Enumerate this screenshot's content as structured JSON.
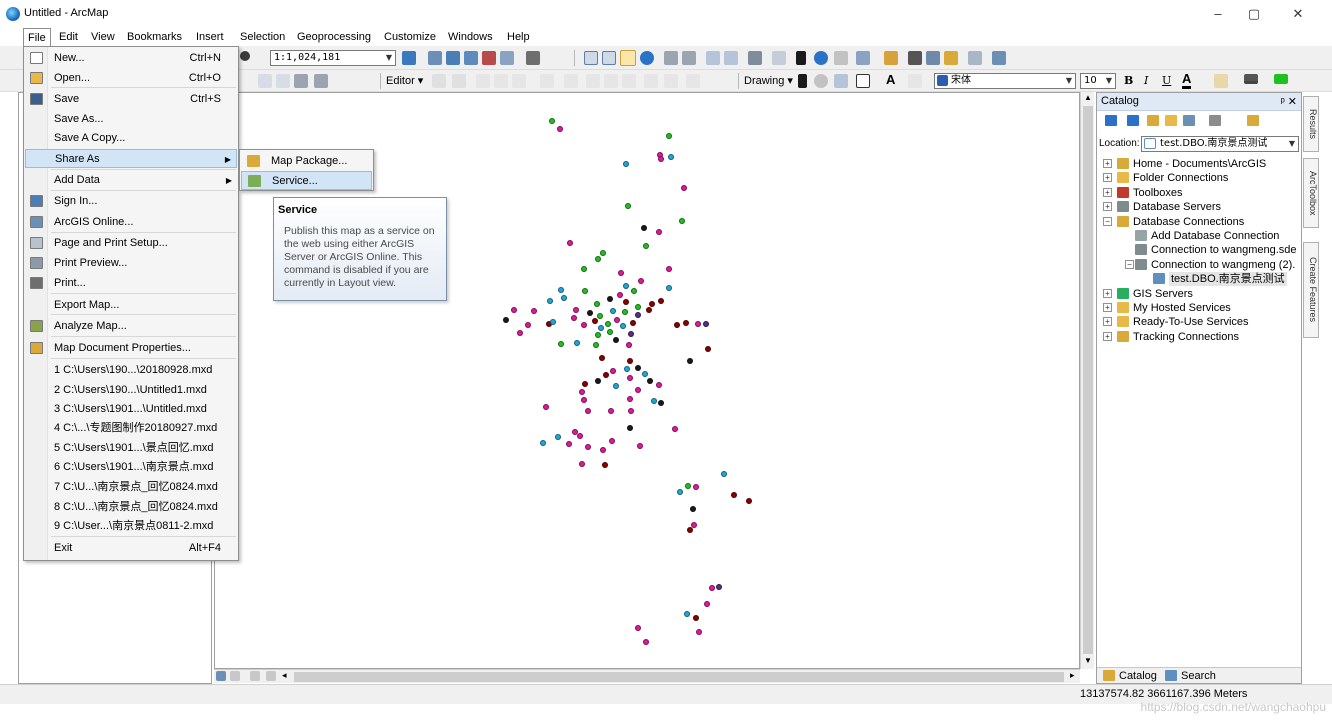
{
  "window": {
    "title": "Untitled - ArcMap",
    "controls": {
      "minimize": "–",
      "maximize": "▢",
      "close": "✕"
    }
  },
  "menubar": {
    "items": [
      "File",
      "Edit",
      "View",
      "Bookmarks",
      "Insert",
      "Selection",
      "Geoprocessing",
      "Customize",
      "Windows",
      "Help"
    ]
  },
  "toolbars": {
    "scale_value": "1:1,024,181",
    "editor_label": "Editor ▾",
    "drawing_label": "Drawing ▾",
    "font_name": "宋体",
    "font_size": "10",
    "bold": "B",
    "italic": "I",
    "underline": "U",
    "font_color_glyph": "A"
  },
  "file_menu": {
    "items": [
      {
        "label": "New...",
        "shortcut": "Ctrl+N",
        "icon": "new-document-icon"
      },
      {
        "label": "Open...",
        "shortcut": "Ctrl+O",
        "icon": "open-folder-icon"
      },
      {
        "label": "Save",
        "shortcut": "Ctrl+S",
        "icon": "save-disk-icon"
      },
      {
        "label": "Save As...",
        "shortcut": ""
      },
      {
        "label": "Save A Copy...",
        "shortcut": ""
      },
      {
        "label": "Share As",
        "shortcut": "",
        "submenu": true,
        "highlighted": true
      },
      {
        "label": "Add Data",
        "shortcut": "",
        "submenu": true
      },
      {
        "label": "Sign In...",
        "shortcut": "",
        "icon": "sign-in-icon"
      },
      {
        "label": "ArcGIS Online...",
        "shortcut": "",
        "icon": "arcgis-online-icon"
      },
      {
        "label": "Page and Print Setup...",
        "shortcut": "",
        "icon": "page-setup-icon"
      },
      {
        "label": "Print Preview...",
        "shortcut": "",
        "icon": "print-preview-icon"
      },
      {
        "label": "Print...",
        "shortcut": "",
        "icon": "printer-icon"
      },
      {
        "label": "Export Map...",
        "shortcut": ""
      },
      {
        "label": "Analyze Map...",
        "shortcut": "",
        "icon": "analyze-map-icon"
      },
      {
        "label": "Map Document Properties...",
        "shortcut": "",
        "icon": "document-properties-icon"
      },
      {
        "label": "1 C:\\Users\\190...\\20180928.mxd",
        "shortcut": ""
      },
      {
        "label": "2 C:\\Users\\190...\\Untitled1.mxd",
        "shortcut": ""
      },
      {
        "label": "3 C:\\Users\\1901...\\Untitled.mxd",
        "shortcut": ""
      },
      {
        "label": "4 C:\\...\\专题图制作20180927.mxd",
        "shortcut": ""
      },
      {
        "label": "5 C:\\Users\\1901...\\景点回忆.mxd",
        "shortcut": ""
      },
      {
        "label": "6 C:\\Users\\1901...\\南京景点.mxd",
        "shortcut": ""
      },
      {
        "label": "7 C:\\U...\\南京景点_回忆0824.mxd",
        "shortcut": ""
      },
      {
        "label": "8 C:\\U...\\南京景点_回忆0824.mxd",
        "shortcut": ""
      },
      {
        "label": "9 C:\\User...\\南京景点0811-2.mxd",
        "shortcut": ""
      },
      {
        "label": "Exit",
        "shortcut": "Alt+F4"
      }
    ]
  },
  "share_as_submenu": {
    "items": [
      {
        "label": "Map Package...",
        "icon": "map-package-icon"
      },
      {
        "label": "Service...",
        "icon": "service-icon",
        "highlighted": true
      }
    ]
  },
  "tooltip": {
    "title": "Service",
    "body": "Publish this map as a service on the web using either ArcGIS Server or ArcGIS Online. This command is disabled if you are currently in Layout view."
  },
  "catalog": {
    "title": "Catalog",
    "pin_close": "ᵖ ✕",
    "location_label": "Location:",
    "location_value": "test.DBO.南京景点测试",
    "tree": [
      {
        "label": "Home - Documents\\ArcGIS",
        "depth": 0,
        "expander": "+",
        "color": "#d9a93a"
      },
      {
        "label": "Folder Connections",
        "depth": 0,
        "expander": "+",
        "color": "#e8b848"
      },
      {
        "label": "Toolboxes",
        "depth": 0,
        "expander": "+",
        "color": "#c0392b"
      },
      {
        "label": "Database Servers",
        "depth": 0,
        "expander": "+",
        "color": "#7f8c8d"
      },
      {
        "label": "Database Connections",
        "depth": 0,
        "expander": "−",
        "color": "#d9a93a"
      },
      {
        "label": "Add Database Connection",
        "depth": 1,
        "expander": "",
        "color": "#95a5a6"
      },
      {
        "label": "Connection to wangmeng.sde",
        "depth": 1,
        "expander": "",
        "color": "#7f8c8d"
      },
      {
        "label": "Connection to wangmeng (2).",
        "depth": 1,
        "expander": "−",
        "color": "#7f8c8d"
      },
      {
        "label": "test.DBO.南京景点测试",
        "depth": 2,
        "expander": "",
        "color": "#5d8fbf",
        "selected": true
      },
      {
        "label": "GIS Servers",
        "depth": 0,
        "expander": "+",
        "color": "#27ae60"
      },
      {
        "label": "My Hosted Services",
        "depth": 0,
        "expander": "+",
        "color": "#e8b848"
      },
      {
        "label": "Ready-To-Use Services",
        "depth": 0,
        "expander": "+",
        "color": "#e8b848"
      },
      {
        "label": "Tracking Connections",
        "depth": 0,
        "expander": "+",
        "color": "#d9a93a"
      }
    ],
    "tabs": [
      "Catalog",
      "Search"
    ]
  },
  "side_tabs": [
    "Results",
    "ArcToolbox",
    "Create Features"
  ],
  "status": {
    "coordinates": "13137574.82  3661167.396 Meters"
  },
  "watermark": "https://blog.csdn.net/wangchaohpu",
  "map_points": {
    "colors": {
      "m": "#e0189b",
      "g": "#20c020",
      "c": "#1fa7d8",
      "r": "#8b0000",
      "b": "#1a1a1a",
      "p": "#5a2d82"
    },
    "points": [
      [
        551,
        120,
        "g"
      ],
      [
        559,
        128,
        "m"
      ],
      [
        668,
        135,
        "g"
      ],
      [
        659,
        154,
        "m"
      ],
      [
        670,
        156,
        "c"
      ],
      [
        660,
        158,
        "m"
      ],
      [
        625,
        163,
        "c"
      ],
      [
        683,
        187,
        "m"
      ],
      [
        627,
        205,
        "g"
      ],
      [
        681,
        220,
        "g"
      ],
      [
        643,
        227,
        "b"
      ],
      [
        658,
        231,
        "m"
      ],
      [
        569,
        242,
        "m"
      ],
      [
        645,
        245,
        "g"
      ],
      [
        602,
        252,
        "g"
      ],
      [
        597,
        258,
        "g"
      ],
      [
        583,
        268,
        "g"
      ],
      [
        668,
        268,
        "m"
      ],
      [
        620,
        272,
        "m"
      ],
      [
        640,
        280,
        "m"
      ],
      [
        625,
        285,
        "c"
      ],
      [
        560,
        289,
        "c"
      ],
      [
        584,
        290,
        "g"
      ],
      [
        619,
        294,
        "m"
      ],
      [
        633,
        290,
        "g"
      ],
      [
        668,
        287,
        "c"
      ],
      [
        549,
        300,
        "c"
      ],
      [
        563,
        297,
        "c"
      ],
      [
        596,
        303,
        "g"
      ],
      [
        609,
        298,
        "b"
      ],
      [
        625,
        301,
        "r"
      ],
      [
        651,
        303,
        "r"
      ],
      [
        660,
        300,
        "r"
      ],
      [
        637,
        306,
        "g"
      ],
      [
        513,
        309,
        "m"
      ],
      [
        533,
        310,
        "m"
      ],
      [
        575,
        309,
        "m"
      ],
      [
        589,
        312,
        "b"
      ],
      [
        599,
        315,
        "g"
      ],
      [
        612,
        310,
        "c"
      ],
      [
        624,
        311,
        "g"
      ],
      [
        637,
        314,
        "p"
      ],
      [
        648,
        309,
        "r"
      ],
      [
        505,
        319,
        "b"
      ],
      [
        527,
        324,
        "m"
      ],
      [
        548,
        323,
        "r"
      ],
      [
        552,
        321,
        "c"
      ],
      [
        573,
        317,
        "m"
      ],
      [
        583,
        324,
        "m"
      ],
      [
        594,
        320,
        "r"
      ],
      [
        600,
        327,
        "c"
      ],
      [
        607,
        323,
        "g"
      ],
      [
        616,
        319,
        "m"
      ],
      [
        622,
        325,
        "c"
      ],
      [
        632,
        322,
        "r"
      ],
      [
        676,
        324,
        "r"
      ],
      [
        685,
        322,
        "r"
      ],
      [
        697,
        323,
        "m"
      ],
      [
        705,
        323,
        "p"
      ],
      [
        519,
        332,
        "m"
      ],
      [
        597,
        334,
        "g"
      ],
      [
        609,
        331,
        "g"
      ],
      [
        630,
        333,
        "p"
      ],
      [
        560,
        343,
        "g"
      ],
      [
        576,
        342,
        "c"
      ],
      [
        595,
        344,
        "g"
      ],
      [
        615,
        339,
        "b"
      ],
      [
        628,
        344,
        "m"
      ],
      [
        707,
        348,
        "r"
      ],
      [
        601,
        357,
        "r"
      ],
      [
        629,
        360,
        "r"
      ],
      [
        689,
        360,
        "b"
      ],
      [
        626,
        368,
        "c"
      ],
      [
        637,
        367,
        "b"
      ],
      [
        605,
        374,
        "r"
      ],
      [
        612,
        370,
        "m"
      ],
      [
        629,
        377,
        "m"
      ],
      [
        644,
        373,
        "c"
      ],
      [
        649,
        380,
        "b"
      ],
      [
        615,
        385,
        "c"
      ],
      [
        584,
        383,
        "r"
      ],
      [
        597,
        380,
        "b"
      ],
      [
        581,
        391,
        "m"
      ],
      [
        658,
        384,
        "m"
      ],
      [
        637,
        389,
        "m"
      ],
      [
        583,
        399,
        "m"
      ],
      [
        629,
        398,
        "m"
      ],
      [
        653,
        400,
        "c"
      ],
      [
        660,
        402,
        "b"
      ],
      [
        545,
        406,
        "m"
      ],
      [
        587,
        410,
        "m"
      ],
      [
        610,
        410,
        "m"
      ],
      [
        630,
        410,
        "m"
      ],
      [
        674,
        428,
        "m"
      ],
      [
        629,
        427,
        "b"
      ],
      [
        574,
        431,
        "m"
      ],
      [
        557,
        436,
        "c"
      ],
      [
        579,
        435,
        "m"
      ],
      [
        611,
        440,
        "m"
      ],
      [
        542,
        442,
        "c"
      ],
      [
        568,
        443,
        "m"
      ],
      [
        587,
        446,
        "m"
      ],
      [
        639,
        445,
        "m"
      ],
      [
        602,
        449,
        "m"
      ],
      [
        581,
        463,
        "m"
      ],
      [
        604,
        464,
        "r"
      ],
      [
        723,
        473,
        "c"
      ],
      [
        687,
        485,
        "g"
      ],
      [
        695,
        486,
        "m"
      ],
      [
        679,
        491,
        "c"
      ],
      [
        733,
        494,
        "r"
      ],
      [
        748,
        500,
        "r"
      ],
      [
        692,
        508,
        "b"
      ],
      [
        693,
        524,
        "m"
      ],
      [
        689,
        529,
        "r"
      ],
      [
        711,
        587,
        "m"
      ],
      [
        718,
        586,
        "p"
      ],
      [
        706,
        603,
        "m"
      ],
      [
        686,
        613,
        "c"
      ],
      [
        695,
        617,
        "r"
      ],
      [
        637,
        627,
        "m"
      ],
      [
        698,
        631,
        "m"
      ],
      [
        645,
        641,
        "m"
      ]
    ]
  }
}
